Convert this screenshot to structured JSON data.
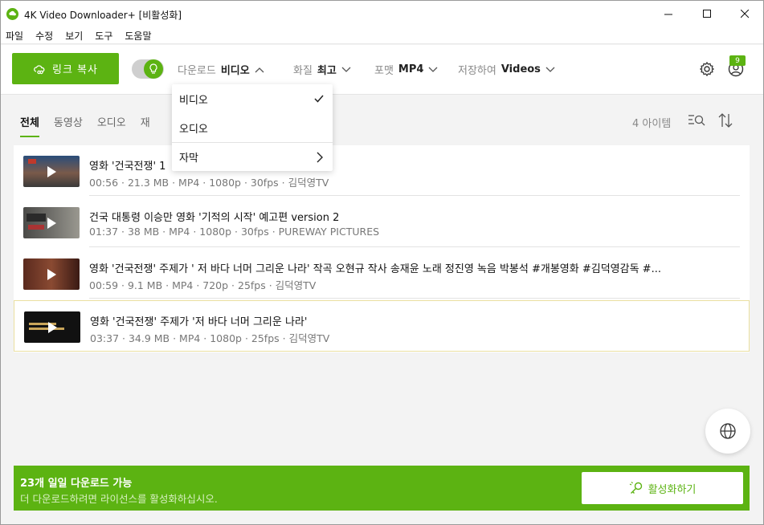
{
  "window": {
    "title": "4K Video Downloader+ [비활성화]"
  },
  "menu": [
    "파일",
    "수정",
    "보기",
    "도구",
    "도움말"
  ],
  "toolbar": {
    "paste_label": "링크 복사",
    "type_label": "다운로드",
    "type_value": "비디오",
    "quality_label": "화질",
    "quality_value": "최고",
    "format_label": "포맷",
    "format_value": "MP4",
    "save_label": "저장하여",
    "save_value": "Videos",
    "account_badge": "9"
  },
  "tabs": [
    "전체",
    "동영상",
    "오디오",
    "재"
  ],
  "item_count": "4 아이템",
  "dropdown": {
    "video": "비디오",
    "audio": "오디오",
    "subtitles": "자막"
  },
  "items": [
    {
      "title": "영화 '건국전쟁' 1",
      "title_suffix": "",
      "meta": "00:56 · 21.3 MB · MP4 · 1080p · 30fps · 김덕영TV"
    },
    {
      "title": "건국 대통령 이승만 영화 '기적의 시작' 예고편 version 2",
      "meta": "01:37 · 38 MB · MP4 · 1080p · 30fps · PUREWAY PICTURES"
    },
    {
      "title": "영화 '건국전쟁' 주제가 ' 저 바다 너머 그리운 나라' 작곡 오현규 작사 송재윤 노래 정진영 녹음 박봉석 #개봉영화 #김덕영감독 #...",
      "meta": "00:59 · 9.1 MB · MP4 · 720p · 25fps · 김덕영TV"
    },
    {
      "title": "영화 '건국전쟁' 주제가 '저 바다 너머 그리운 나라'",
      "meta": "03:37 · 34.9 MB · MP4 · 1080p · 25fps · 김덕영TV"
    }
  ],
  "banner": {
    "title": "23개 일일 다운로드 가능",
    "subtitle": "더 다운로드하려면 라이선스를 활성화하십시오.",
    "activate_label": "활성화하기"
  },
  "colors": {
    "accent": "#5cb312"
  }
}
